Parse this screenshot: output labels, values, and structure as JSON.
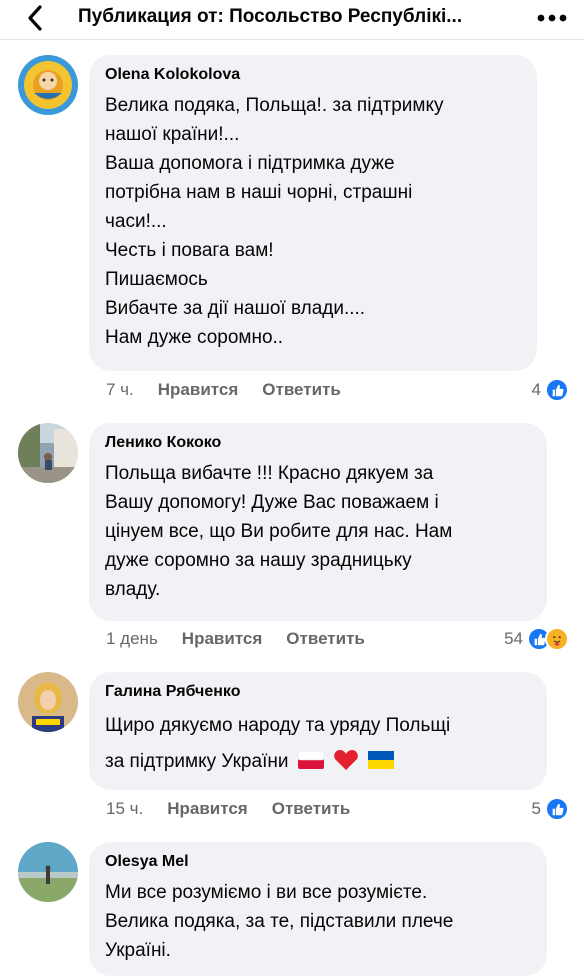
{
  "header": {
    "title": "Публикация от: Посольство Республікі...",
    "back_icon": "chevron-left-icon",
    "more_icon": "more-dots-icon"
  },
  "comments": [
    {
      "author": "Olena Kolokolova",
      "lines": [
        "Велика подяка, Польща!. за підтримку",
        "нашої країни!...",
        "Ваша допомога і підтримка дуже",
        "потрібна нам в наші чорні, страшні",
        "часи!...",
        "Честь і повага вам!",
        "Пишаємось",
        "Вибачте за дії нашої влади....",
        "Нам дуже соромно.."
      ],
      "time": "7 ч.",
      "like": "Нравится",
      "reply": "Ответить",
      "reaction_count": "4",
      "reactions": [
        "like-icon"
      ]
    },
    {
      "author": "Ленико Кококо",
      "lines": [
        "Польща вибачте !!! Красно дякуем за",
        "Вашу допомогу! Дуже Вас поважаем і",
        "цінуем все, що Ви робите для нас. Нам",
        "дуже соромно за нашу зрадницьку",
        "владу."
      ],
      "time": "1 день",
      "like": "Нравится",
      "reply": "Ответить",
      "reaction_count": "54",
      "reactions": [
        "like-icon",
        "care-icon"
      ]
    },
    {
      "author": "Галина Рябченко",
      "lines": [
        "Щиро дякуємо народу та уряду Польщі",
        "за підтримку України"
      ],
      "emoji": [
        "flag-poland-icon",
        "red-heart-icon",
        "flag-ukraine-icon"
      ],
      "time": "15 ч.",
      "like": "Нравится",
      "reply": "Ответить",
      "reaction_count": "5",
      "reactions": [
        "like-icon"
      ]
    },
    {
      "author": "Olesya Mel",
      "lines": [
        "Ми все розуміємо і ви все розумієте.",
        "Велика подяка, за те, підставили плече",
        "Україні."
      ]
    }
  ],
  "colors": {
    "bubble": "#f0f2f5",
    "meta": "#65676b",
    "like_blue": "#1877f2",
    "care_yellow": "#f7b125"
  }
}
